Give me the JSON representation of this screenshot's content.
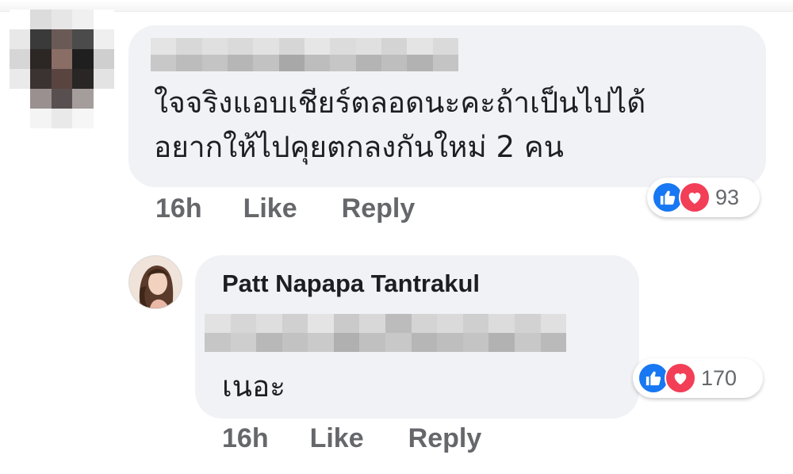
{
  "comment": {
    "text_line1": "ใจจริงแอบเชียร์ตลอดนะคะถ้าเป็นไปได้",
    "text_line2": "อยากให้ไปคุยตกลงกันใหม่ 2 คน",
    "time": "16h",
    "like_label": "Like",
    "reply_label": "Reply",
    "reaction_count": "93",
    "reaction_icons": [
      "like-icon",
      "love-icon"
    ]
  },
  "reply": {
    "author": "Patt Napapa Tantrakul",
    "text": "เนอะ",
    "time": "16h",
    "like_label": "Like",
    "reply_label": "Reply",
    "reaction_count": "170",
    "reaction_icons": [
      "like-icon",
      "love-icon"
    ]
  },
  "colors": {
    "bubble_bg": "#f0f2f5",
    "text": "#1c1e21",
    "meta_text": "#65676b",
    "like_blue": "#1877f2",
    "love_red": "#f33e58"
  }
}
